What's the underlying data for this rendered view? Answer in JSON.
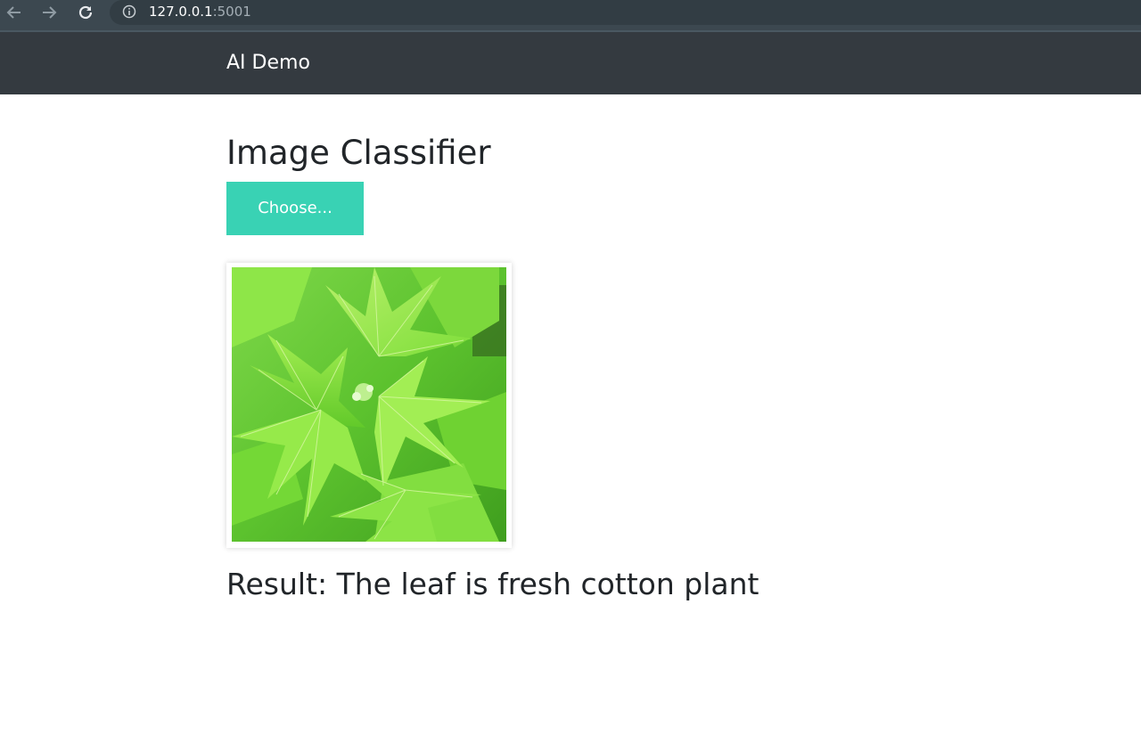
{
  "browser": {
    "url_host": "127.0.0.1",
    "url_port": ":5001"
  },
  "navbar": {
    "brand": "AI Demo"
  },
  "main": {
    "title": "Image Classifier",
    "choose_label": "Choose...",
    "result_prefix": "Result:",
    "result_text": "The leaf is fresh cotton plant"
  },
  "colors": {
    "navbar_bg": "#343a40",
    "button_bg": "#39d2b4",
    "browser_bg": "#3c4850"
  },
  "icons": {
    "back": "arrow-left-icon",
    "forward": "arrow-right-icon",
    "reload": "reload-icon",
    "info": "info-icon"
  }
}
